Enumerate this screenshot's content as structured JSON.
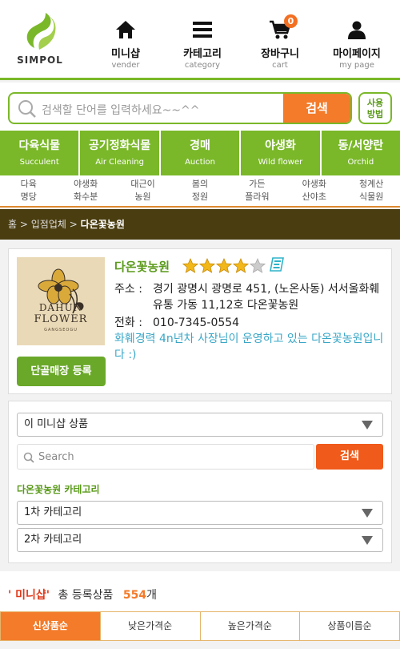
{
  "brand": {
    "name": "SIMPOL"
  },
  "nav": [
    {
      "label": "미니샵",
      "sub": "vender",
      "icon": "home-icon"
    },
    {
      "label": "카테고리",
      "sub": "category",
      "icon": "menu-icon"
    },
    {
      "label": "장바구니",
      "sub": "cart",
      "icon": "cart-icon",
      "badge": "0"
    },
    {
      "label": "마이페이지",
      "sub": "my page",
      "icon": "user-icon"
    }
  ],
  "search": {
    "placeholder": "검색할 단어를 입력하세요~~^^",
    "button": "검색",
    "usage": "사용\n방법"
  },
  "categories": [
    {
      "label": "다육식물",
      "sub": "Succulent"
    },
    {
      "label": "공기정화식물",
      "sub": "Air Cleaning"
    },
    {
      "label": "경매",
      "sub": "Auction"
    },
    {
      "label": "야생화",
      "sub": "Wild flower"
    },
    {
      "label": "동/서양란",
      "sub": "Orchid"
    }
  ],
  "subcategories": [
    {
      "l1": "다육",
      "l2": "명당"
    },
    {
      "l1": "야생화",
      "l2": "화수분"
    },
    {
      "l1": "대근이",
      "l2": "농원"
    },
    {
      "l1": "봄의",
      "l2": "정원"
    },
    {
      "l1": "가든",
      "l2": "플라워"
    },
    {
      "l1": "야생화",
      "l2": "산야초"
    },
    {
      "l1": "청계산",
      "l2": "식물원"
    }
  ],
  "breadcrumb": {
    "home": "홈",
    "sep": ">",
    "vendor": "입점업체",
    "current": "다온꽃농원"
  },
  "store": {
    "name": "다온꽃농원",
    "rating": 4,
    "rating_max": 5,
    "address_label": "주소 :",
    "address": "경기 광명시 광명로 451, (노온사동) 서서울화훼유통 가동 11,12호 다온꽃농원",
    "phone_label": "전화 :",
    "phone": "010-7345-0554",
    "description": "화훼경력 4n년차 사장님이 운영하고 있는 다온꽃농원입니다 :)",
    "image_text_1": "DAHUN",
    "image_text_2": "FLOWER",
    "image_text_3": "GANGSEOGU",
    "regular_button": "단골매장 등록"
  },
  "filter": {
    "scope_select": "이 미니샵 상품",
    "search_placeholder": "Search",
    "search_button": "검색",
    "category_heading": "다온꽃농원 카테고리",
    "cat1_select": "1차 카테고리",
    "cat2_select": "2차 카테고리"
  },
  "summary": {
    "mini": "' 미니샵'",
    "text": "총 등록상품",
    "count": "554",
    "unit": "개"
  },
  "sort_tabs": [
    "신상품순",
    "낮은가격순",
    "높은가격순",
    "상품이름순"
  ],
  "colors": {
    "green": "#7ab829",
    "orange": "#f37b2a",
    "brown": "#4a3d10"
  }
}
